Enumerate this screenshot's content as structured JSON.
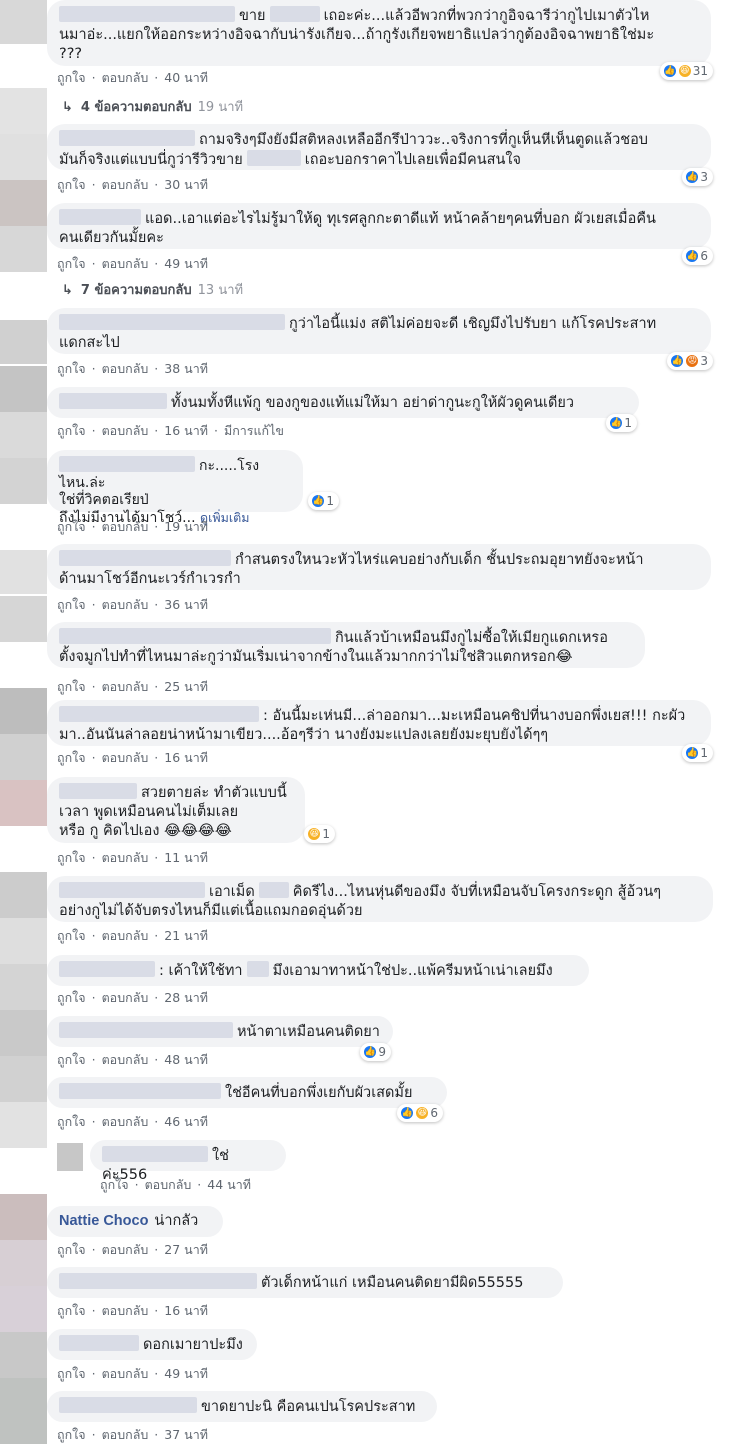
{
  "labels": {
    "like": "ถูกใจ",
    "reply": "ตอบกลับ",
    "edited": "มีการแก้ไข",
    "see_more": "ดูเพิ่มเติม"
  },
  "comments": [
    {
      "lines": [
        "ขาย",
        "เถอะค่ะ...แล้วอีพวกที่พวกว่ากูอิจฉารีว่ากูไปเมาตัวไห",
        "นมาอ่ะ...แยกให้ออกระหว่างอิจฉากับน่ารังเกียจ...ถ้ากูรังเกียจพยาธิแปลว่ากูต้องอิจฉาพยาธิใช่มะ",
        "???"
      ],
      "time": "40 นาที",
      "reactions": "31"
    },
    {
      "lines": [
        "ถามจริงๆมึงยังมีสติหลงเหลืออีกรึป่าววะ..จริงการที่กูเห็นหีเห็นตูดแล้วชอบ",
        "มันก็จริงแต่แบบนี่กูว่ารีวิวขาย",
        "เถอะบอกราคาไปเลยเพื่อมีคนสนใจ"
      ],
      "time": "30 นาที",
      "reactions": "3"
    },
    {
      "lines": [
        "แอด..เอาแต่อะไรไม่รู้มาให้ดู ทุเรศลูกกะตาดีแท้ หน้าคล้ายๆคนที่บอก ผัวเยสเมื่อคืน",
        "คนเดียวกันมั้ยคะ"
      ],
      "time": "49 นาที",
      "reactions": "6"
    },
    {
      "lines": [
        "กูว่าไอนี้แม่ง สติไม่ค่อยจะดี เชิญมึงไปรับยา แก้โรคประสาท",
        "แดกสะไป"
      ],
      "time": "38 นาที",
      "reactions": "3"
    },
    {
      "lines": [
        "ทั้งนมทั้งหีแพ้กู ของกูของแท้แม่ให้มา อย่าด่ากูนะกูให้ผัวดูคนเดียว"
      ],
      "time": "16 นาที",
      "reactions": "1"
    },
    {
      "lines": [
        "กะ.....โรงไหน.ล่ะ",
        "ใช่ที่วิคตอเรียป่",
        "ถึงไม่มีงานได้มาโชว์..."
      ],
      "time": "19 นาที",
      "reactions": "1"
    },
    {
      "lines": [
        "กำสนตรงใหนวะหัวไหร่แคบอย่างกับเด็ก ชั้นประถมอุยาทยังจะหน้า",
        "ด้านมาโชว์อีกนะเวร์กำเวรกำ"
      ],
      "time": "36 นาที"
    },
    {
      "lines": [
        "กินแล้วบ้าเหมือนมึงกูไม่ซื้อให้เมียกูแดกเหรอ",
        "ตั้งจมูกไปทำที่ไหนมาล่ะกูว่ามันเริ่มเน่าจากข้างในแล้วมากกว่าไม่ใช่สิวแตกหรอก😂"
      ],
      "time": "25 นาที"
    },
    {
      "lines": [
        ": อันนี้มะเห่นมี...ล่าออกมา...มะเหมือนคชิปที่นางบอกพึ่งเยส!!! กะผัว",
        "มา..อันนันล่าลอยน่าหน้ามาเขียว....อ้อๆรีว่า นางยังมะแปลงเลยยังมะยุบยังได้ๆๆ"
      ],
      "time": "16 นาที",
      "reactions": "1"
    },
    {
      "lines": [
        "สวยตายล่ะ ทำตัวแบบนี้",
        "เวลา พูดเหมือนคนไม่เต็มเลย",
        "หรือ กู คิดไปเอง 😂😂😂😂"
      ],
      "time": "11 นาที",
      "reactions": "1"
    },
    {
      "lines": [
        "เอาเม็ด",
        "คิดรีไง...ไหนหุ่นดีของมึง จับที่เหมือนจับโครงกระดูก สู้อ้วนๆ",
        "อย่างกูไม่ได้จับตรงไหนก็มีแต่เนื้อแถมกอดอุ่นด้วย"
      ],
      "time": "21 นาที"
    },
    {
      "lines": [
        ": เค้าให้ใช้ทา",
        "มึงเอามาทาหน้าใช่ปะ..แพ้ครีมหน้าเน่าเลยมึง"
      ],
      "time": "28 นาที"
    },
    {
      "lines": [
        "หน้าตาเหมือนคนติดยา"
      ],
      "time": "48 นาที",
      "reactions": "9"
    },
    {
      "lines": [
        "ใช่อีคนที่บอกพึ่งเยกับผัวเสดมั้ย"
      ],
      "time": "46 นาที",
      "reactions": "6"
    },
    {
      "lines": [
        "ใช่ค่ะ556"
      ],
      "time": "44 นาที"
    },
    {
      "name": "Nattie Choco",
      "lines": [
        "น่ากลัว"
      ],
      "time": "27 นาที"
    },
    {
      "lines": [
        "ตัวเด็กหน้าแก่ เหมือนคนติดยามีผิด55555"
      ],
      "time": "16 นาที"
    },
    {
      "lines": [
        "ดอกเมายาปะมึง"
      ],
      "time": "49 นาที"
    },
    {
      "lines": [
        "ขาดยาปะนิ คือคนเปนโรคประสาท"
      ],
      "time": "37 นาที"
    }
  ],
  "reply_threads": [
    {
      "label": "4 ข้อความตอบกลับ",
      "time": "19 นาที"
    },
    {
      "label": "7 ข้อความตอบกลับ",
      "time": "13 นาที"
    }
  ],
  "colors": {
    "bubble": "#f2f3f5",
    "link": "#385898",
    "like": "#1877f2",
    "haha": "#f7b125"
  }
}
